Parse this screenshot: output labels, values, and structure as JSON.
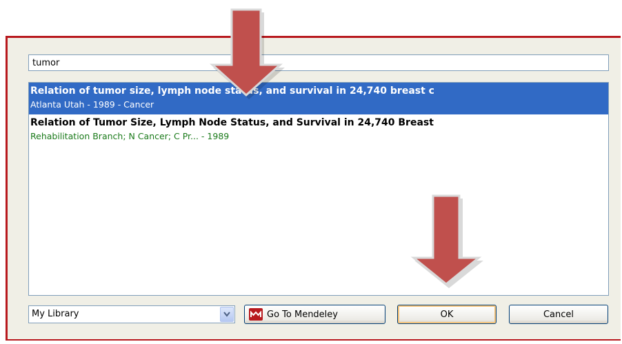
{
  "search": {
    "value": "tumor"
  },
  "results": [
    {
      "title": "Relation of tumor size, lymph node status, and survival in 24,740 breast c",
      "meta": "Atlanta Utah - 1989 - Cancer",
      "selected": true
    },
    {
      "title": "Relation of Tumor Size, Lymph Node Status, and Survival in 24,740 Breast",
      "meta": "Rehabilitation Branch; N Cancer; C Pr... - 1989",
      "selected": false
    }
  ],
  "footer": {
    "library_value": "My Library",
    "go_to_mendeley_label": "Go To Mendeley",
    "ok_label": "OK",
    "cancel_label": "Cancel"
  },
  "icons": {
    "dropdown": "chevron-down-icon",
    "mendeley": "mendeley-logo-icon",
    "annotation_arrow": "arrow-down-icon"
  },
  "colors": {
    "frame_border": "#b8191e",
    "selection": "#316ac5",
    "meta_text": "#1a7a1a",
    "arrow": "#c0504d"
  }
}
